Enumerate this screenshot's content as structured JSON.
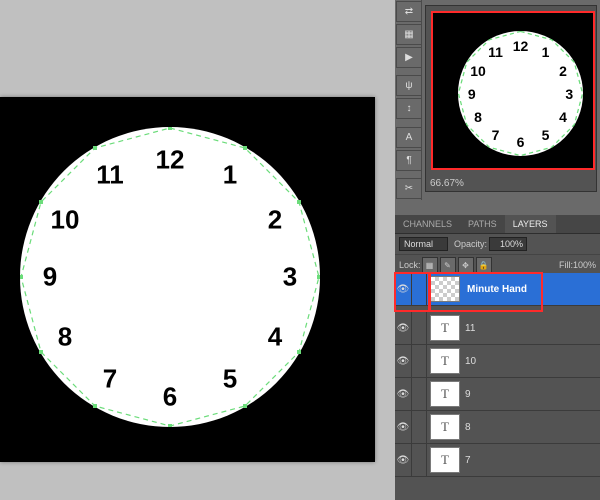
{
  "zoom": "66.67%",
  "tabs": {
    "channels": "CHANNELS",
    "paths": "PATHS",
    "layers": "LAYERS"
  },
  "blend": {
    "mode": "Normal",
    "opacityLabel": "Opacity:",
    "opacity": "100%",
    "fillLabel": "Fill:",
    "fill": "100%",
    "lockLabel": "Lock:"
  },
  "layers": {
    "selected": "Minute Hand",
    "l11": "11",
    "l10": "10",
    "l9": "9",
    "l8": "8",
    "l7": "7"
  },
  "clock": {
    "n1": "1",
    "n2": "2",
    "n3": "3",
    "n4": "4",
    "n5": "5",
    "n6": "6",
    "n7": "7",
    "n8": "8",
    "n9": "9",
    "n10": "10",
    "n11": "11",
    "n12": "12"
  },
  "tool": {
    "a": "⇄",
    "b": "▦",
    "c": "▶",
    "d": "ψ",
    "e": "↕",
    "f": "A",
    "g": "¶",
    "h": "✂"
  }
}
